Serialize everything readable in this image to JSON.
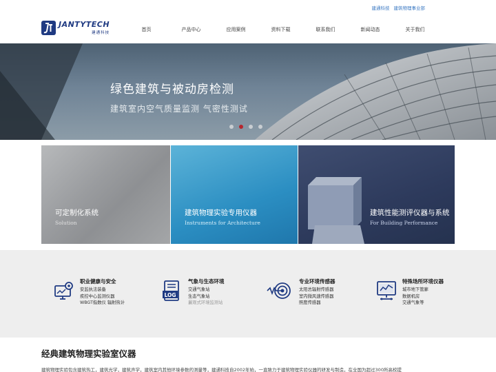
{
  "top_links": [
    "建通科技",
    "建筑物理事业部"
  ],
  "logo": {
    "title": "JANTYTECH",
    "subtitle": "建通科技"
  },
  "nav": [
    "首页",
    "产品中心",
    "应用案例",
    "资料下载",
    "联系我们",
    "新闻动态",
    "关于我们"
  ],
  "banner": {
    "title": "绿色建筑与被动房检测",
    "subtitle": "建筑室内空气质量监测 气密性测试",
    "slides": 4,
    "active_slide": 2
  },
  "tiles": [
    {
      "title": "可定制化系统",
      "subtitle": "Solution"
    },
    {
      "title": "建筑物理实验专用仪器",
      "subtitle": "Instruments for Architecture"
    },
    {
      "title": "建筑性能测评仪器与系统",
      "subtitle": "For Building Performance"
    }
  ],
  "features": [
    {
      "icon": "monitor-gear-icon",
      "title": "职业健康与安全",
      "lines": [
        "安监执法装备",
        "疾控中心监测仪器",
        "WBGT指数仪  辐射热计"
      ]
    },
    {
      "icon": "log-file-icon",
      "title": "气象与生态环境",
      "lines": [
        "交通气象站",
        "生态气象站",
        "曩观式环境监测站"
      ]
    },
    {
      "icon": "sensor-target-icon",
      "title": "专业环境传感器",
      "lines": [
        "太阳总辐射传感器",
        "室内微风速传感器",
        "照度传感器"
      ]
    },
    {
      "icon": "chart-monitor-icon",
      "title": "特殊场所环境仪器",
      "lines": [
        "城市地下管廊",
        "数据机房",
        "交通气象等"
      ]
    }
  ],
  "section": {
    "title": "经典建筑物理实验室仪器",
    "description": "建筑物理实验包含建筑热工，建筑光学，建筑声学，建筑室内其他环境参数的测量等，建通科技自2002年始，一直致力于建筑物理实验仪器的研发与制造，在全国为超过300所高校提"
  },
  "colors": {
    "brand": "#1f3a82",
    "link": "#3b79c3",
    "active_dot": "#b6262e",
    "band": "#eeeeee"
  }
}
